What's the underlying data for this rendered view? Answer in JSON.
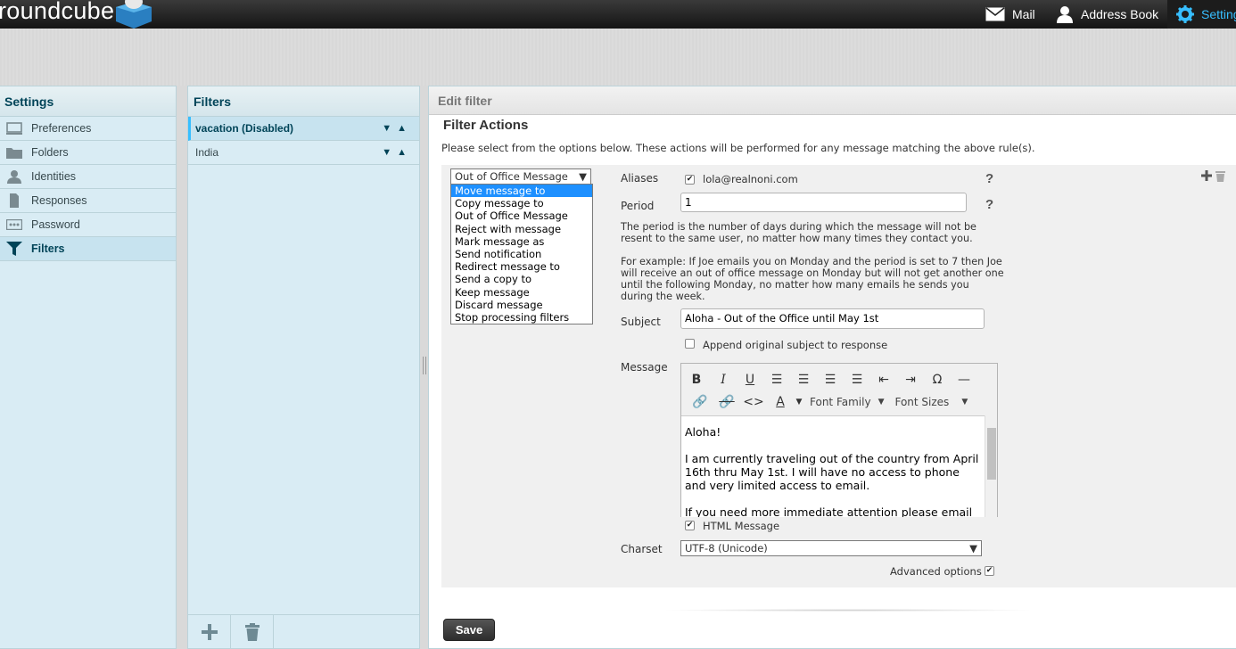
{
  "app": {
    "logo_text": "roundcube"
  },
  "topnav": {
    "mail": "Mail",
    "address_book": "Address Book",
    "settings": "Settings"
  },
  "settings_panel": {
    "title": "Settings",
    "items": [
      {
        "label": "Preferences",
        "icon": "monitor-icon"
      },
      {
        "label": "Folders",
        "icon": "folder-icon"
      },
      {
        "label": "Identities",
        "icon": "user-icon"
      },
      {
        "label": "Responses",
        "icon": "document-icon"
      },
      {
        "label": "Password",
        "icon": "password-icon"
      },
      {
        "label": "Filters",
        "icon": "filter-icon"
      }
    ]
  },
  "filters_panel": {
    "title": "Filters",
    "filters": [
      {
        "name": "vacation (Disabled)"
      },
      {
        "name": "India"
      }
    ]
  },
  "edit_filter": {
    "title": "Edit filter",
    "section_title": "Filter Actions",
    "section_desc": "Please select from the options below. These actions will be performed for any message matching the above rule(s).",
    "action_selected": "Out of Office Message",
    "action_options": [
      "Move message to",
      "Copy message to",
      "Out of Office Message",
      "Reject with message",
      "Mark message as",
      "Send notification",
      "Redirect message to",
      "Send a copy to",
      "Keep message",
      "Discard message",
      "Stop processing filters"
    ],
    "aliases_label": "Aliases",
    "alias_value": "lola@realnoni.com",
    "period_label": "Period",
    "period_value": "1",
    "period_help_1": "The period is the number of days during which the message will not be resent to the same user, no matter how many times they contact you.",
    "period_help_2": "For example: If Joe emails you on Monday and the period is set to 7 then Joe will receive an out of office message on Monday but will not get another one until the following Monday, no matter how many emails he sends you during the week.",
    "subject_label": "Subject",
    "subject_value": "Aloha - Out of the Office until May 1st",
    "append_label": "Append original subject to response",
    "message_label": "Message",
    "font_family": "Font Family",
    "font_sizes": "Font Sizes",
    "message_line1": "Aloha!",
    "message_line2": "I am currently traveling out of the country from April 16th thru May 1st. I will have no access to phone and very limited access to email.",
    "message_line3": "If you need more immediate attention please email",
    "html_message_label": "HTML Message",
    "charset_label": "Charset",
    "charset_value": "UTF-8 (Unicode)",
    "advanced_label": "Advanced options",
    "help_mark": "?",
    "save_label": "Save"
  },
  "colors": {
    "accent": "#37beff",
    "panel_bg": "#d9ecf4",
    "header_text": "#004458"
  }
}
